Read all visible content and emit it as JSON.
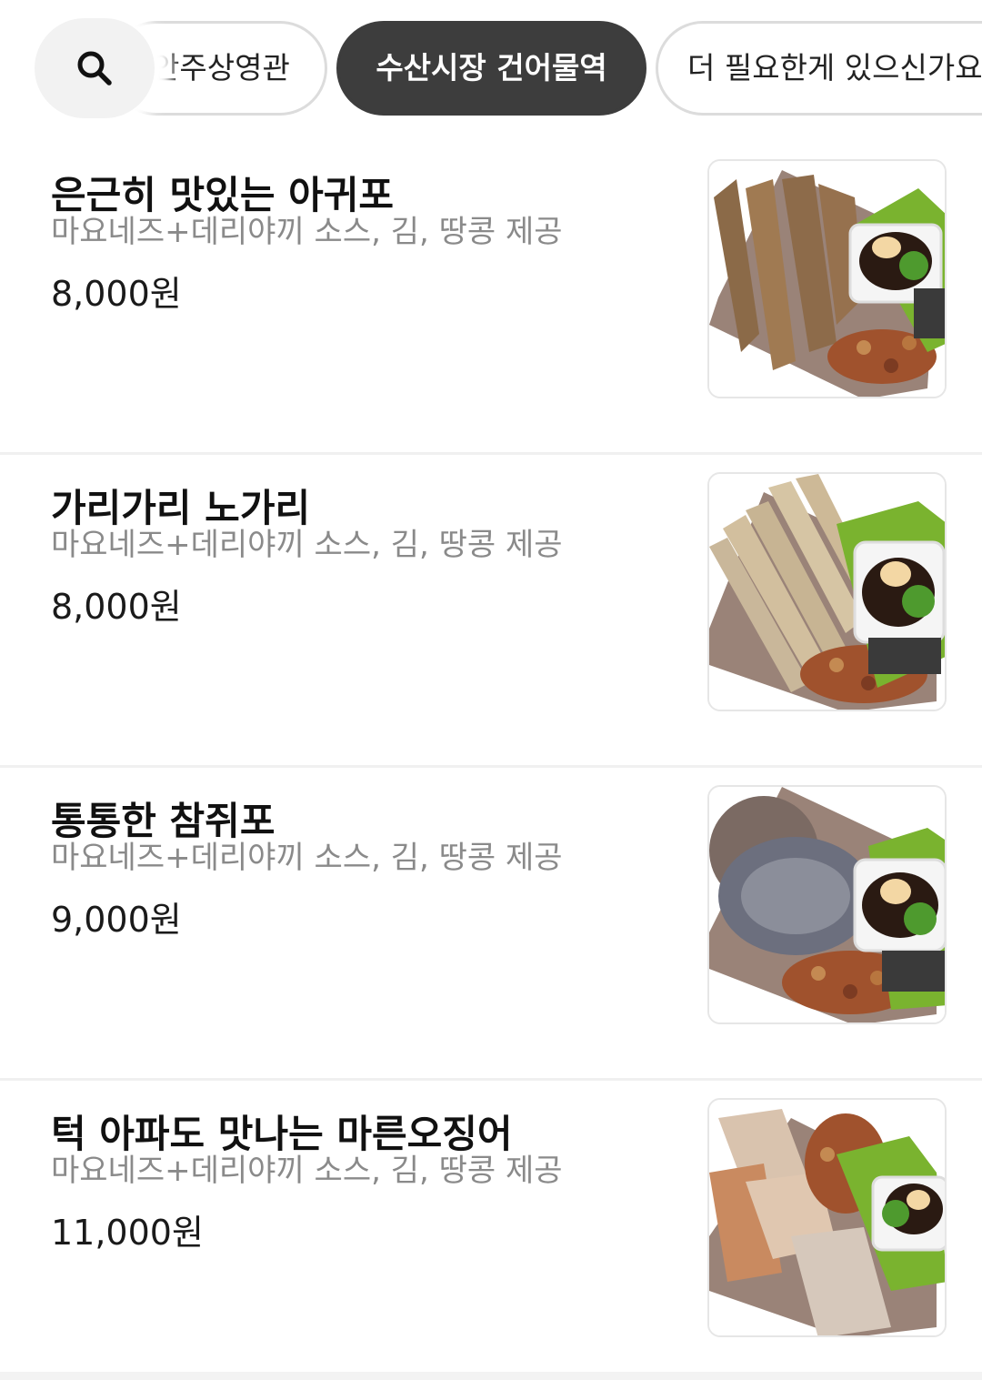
{
  "categories": {
    "tabs": [
      {
        "label": "안주상영관",
        "active": false
      },
      {
        "label": "수산시장 건어물역",
        "active": true
      },
      {
        "label": "더 필요한게 있으신가요",
        "active": false
      }
    ]
  },
  "menu": {
    "items": [
      {
        "name": "은근히 맛있는 아귀포",
        "desc": "마요네즈+데리야끼 소스, 김, 땅콩 제공",
        "price": "8,000원"
      },
      {
        "name": "가리가리 노가리",
        "desc": "마요네즈+데리야끼 소스, 김, 땅콩 제공",
        "price": "8,000원"
      },
      {
        "name": "통통한 참쥐포",
        "desc": "마요네즈+데리야끼 소스, 김, 땅콩 제공",
        "price": "9,000원"
      },
      {
        "name": "턱 아파도 맛나는 마른오징어",
        "desc": "마요네즈+데리야끼 소스, 김, 땅콩 제공",
        "price": "11,000원"
      }
    ]
  },
  "colors": {
    "active_tab_bg": "#3d3d3d",
    "tab_border": "#dcdcdc",
    "desc_text": "#8a8a8a",
    "search_bg": "#f2f2f2"
  }
}
